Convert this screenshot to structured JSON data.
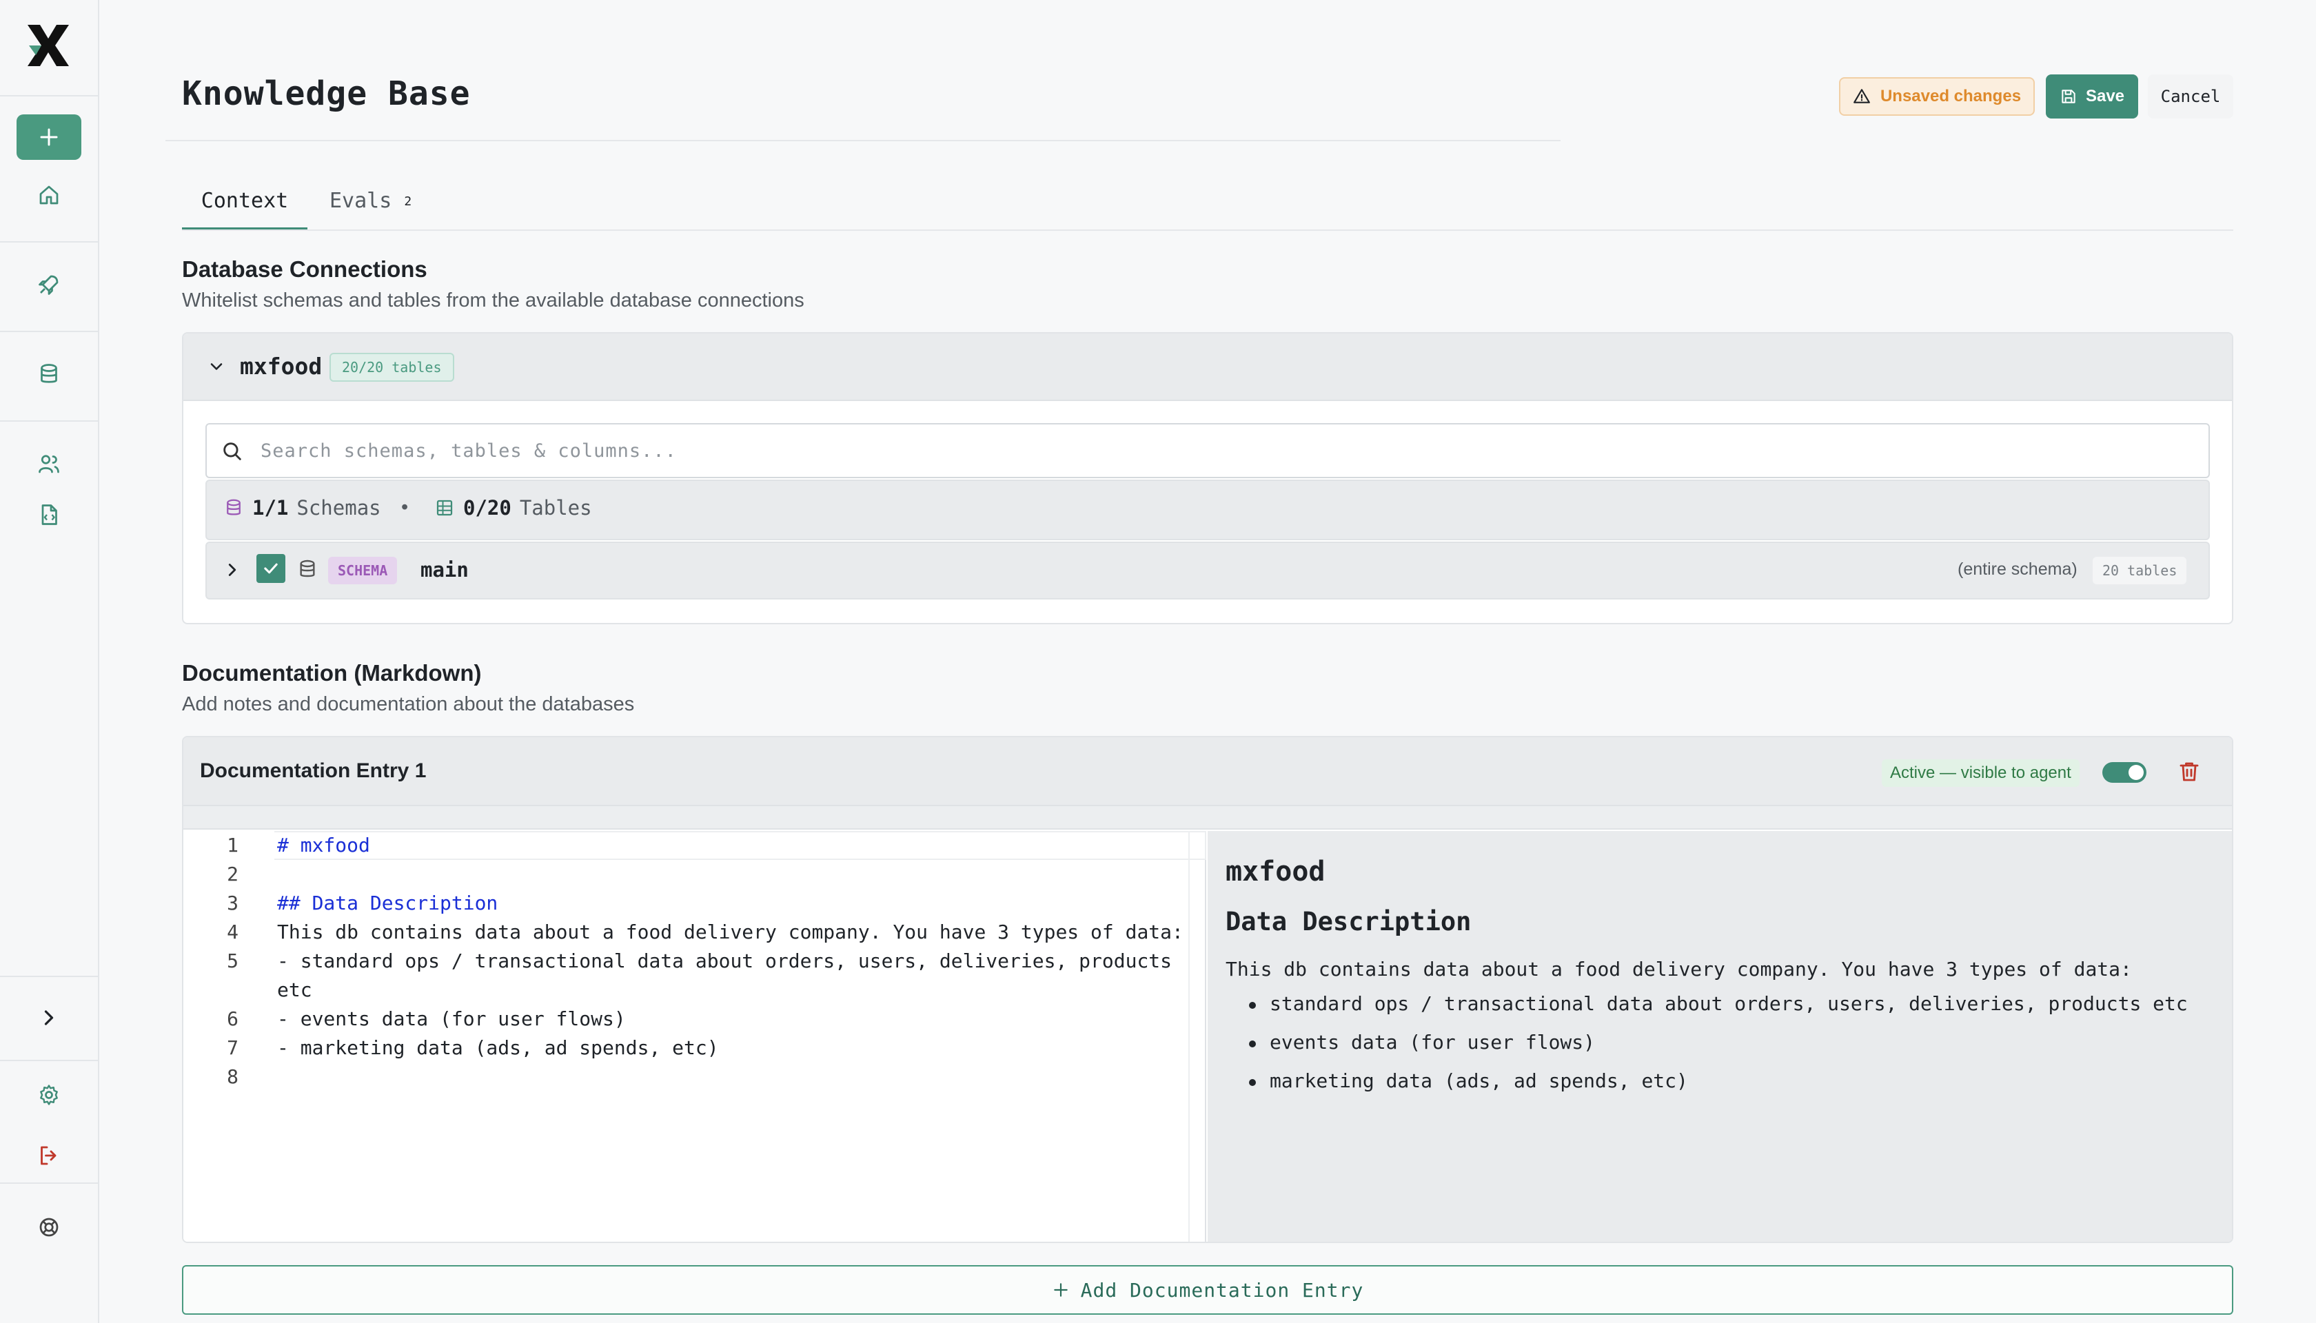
{
  "page": {
    "title": "Knowledge Base",
    "unsaved_label": "Unsaved changes",
    "save_label": "Save",
    "cancel_label": "Cancel"
  },
  "colors": {
    "accent": "#3f8c78",
    "warning": "#de8a2c",
    "danger": "#c0392b",
    "schema_purple": "#9b59b6"
  },
  "sidebar": {
    "items": [
      {
        "icon": "plus-icon"
      },
      {
        "icon": "home-icon"
      },
      {
        "icon": "rocket-icon"
      },
      {
        "icon": "database-icon"
      },
      {
        "icon": "users-icon"
      },
      {
        "icon": "file-code-icon"
      },
      {
        "icon": "chevron-right-icon"
      },
      {
        "icon": "gear-icon"
      },
      {
        "icon": "logout-icon"
      },
      {
        "icon": "help-lifebuoy-icon"
      }
    ]
  },
  "tabs": [
    {
      "label": "Context",
      "active": true
    },
    {
      "label": "Evals",
      "count": "2"
    }
  ],
  "db_section": {
    "title": "Database Connections",
    "subtitle": "Whitelist schemas and tables from the available database connections",
    "connection": {
      "name": "mxfood",
      "badge": "20/20 tables",
      "search_placeholder": "Search schemas, tables & columns...",
      "schemas_count": "1/1",
      "schemas_label": "Schemas",
      "separator": "•",
      "tables_count": "0/20",
      "tables_label": "Tables",
      "schema": {
        "tag": "SCHEMA",
        "name": "main",
        "scope": "(entire schema)",
        "tables_badge": "20 tables",
        "checked": true
      }
    }
  },
  "doc_section": {
    "title": "Documentation (Markdown)",
    "subtitle": "Add notes and documentation about the databases",
    "entry": {
      "title": "Documentation Entry 1",
      "status": "Active — visible to agent",
      "toggle_on": true,
      "lines": [
        {
          "n": "1",
          "text": "# mxfood"
        },
        {
          "n": "2",
          "text": ""
        },
        {
          "n": "3",
          "text": "## Data Description"
        },
        {
          "n": "4",
          "text": "This db contains data about a food delivery company. You have 3 types of data:"
        },
        {
          "n": "5",
          "text": "- standard ops / transactional data about orders, users, deliveries, products etc"
        },
        {
          "n": "6",
          "text": "- events data (for user flows)"
        },
        {
          "n": "7",
          "text": "- marketing data (ads, ad spends, etc)"
        },
        {
          "n": "8",
          "text": ""
        }
      ],
      "preview": {
        "h1": "mxfood",
        "h2": "Data Description",
        "p": "This db contains data about a food delivery company. You have 3 types of data:",
        "bullets": [
          "standard ops / transactional data about orders, users, deliveries, products etc",
          "events data (for user flows)",
          "marketing data (ads, ad spends, etc)"
        ]
      }
    },
    "add_label": "Add Documentation Entry"
  }
}
